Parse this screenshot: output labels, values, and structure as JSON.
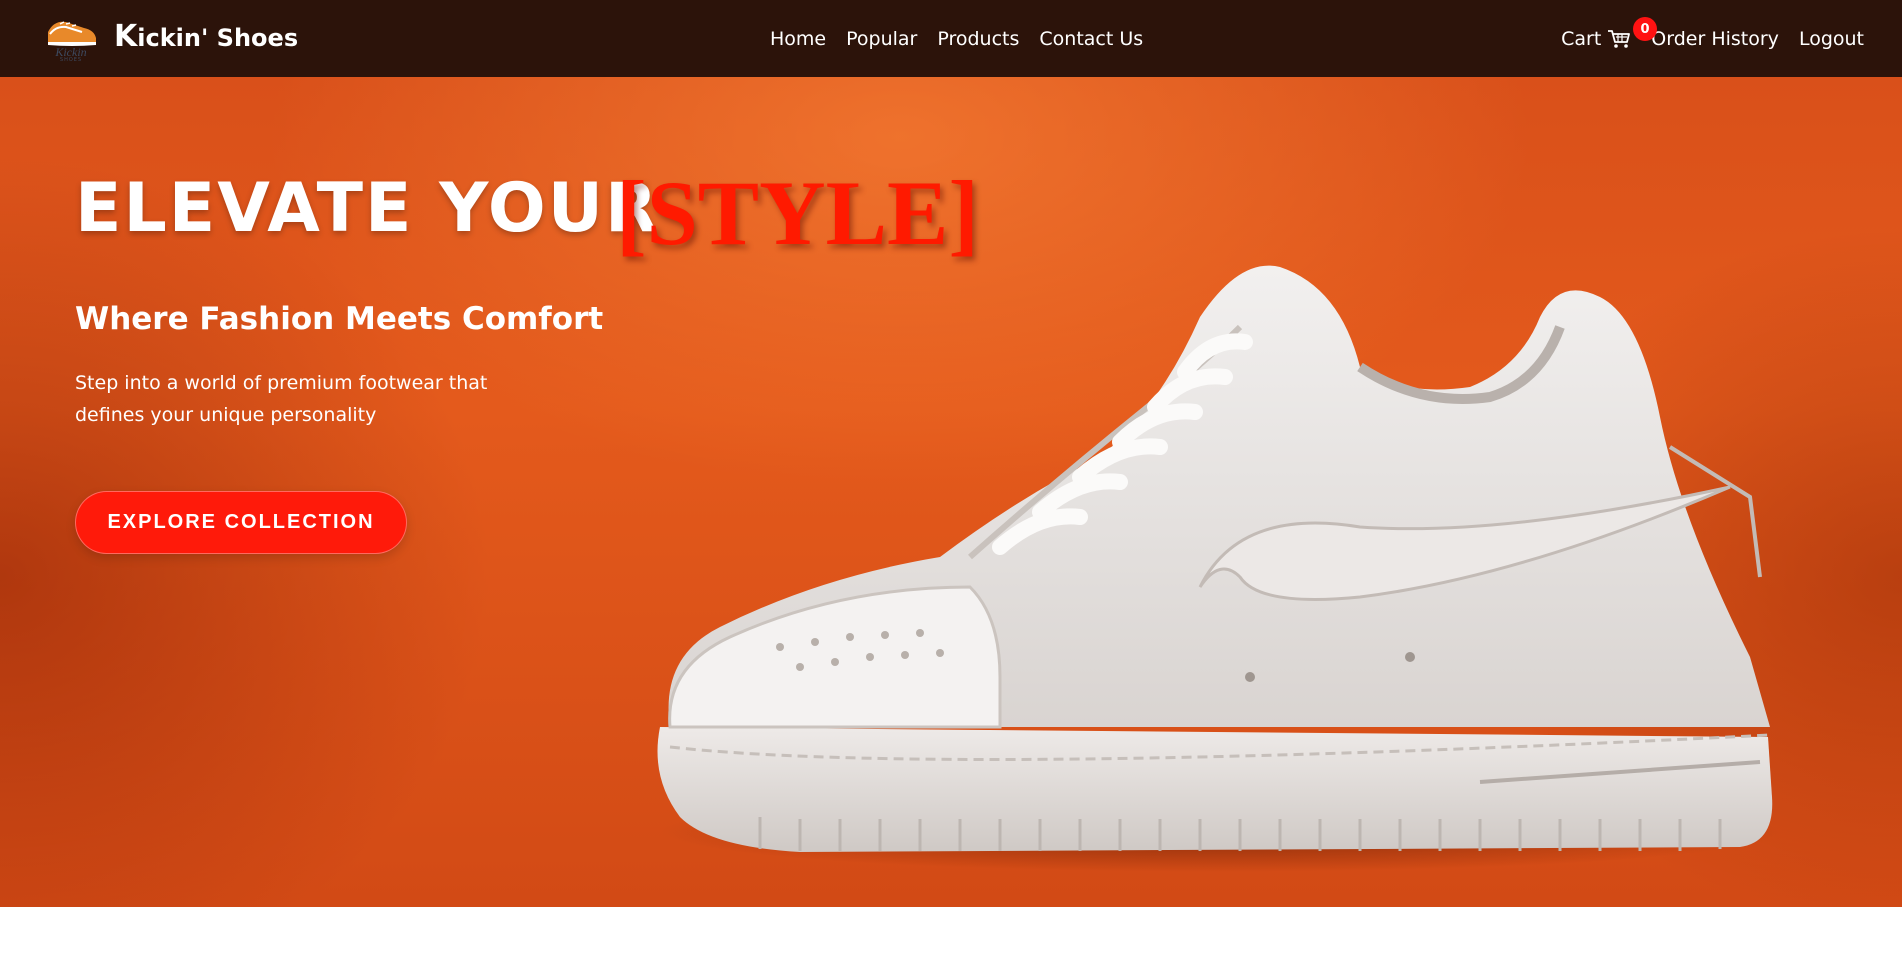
{
  "colors": {
    "navbar_bg": "#2c130a",
    "hero_bg": "#e0561c",
    "accent": "#ff1a00",
    "button_bg": "#ff1a0a",
    "badge_bg": "#ff1212"
  },
  "brand": {
    "logo_icon": "sneaker-logo-icon",
    "name_initial": "K",
    "name_rest": "ickin' Shoes"
  },
  "nav": {
    "home": "Home",
    "popular": "Popular",
    "products": "Products",
    "contact": "Contact Us"
  },
  "nav_right": {
    "cart_label": "Cart",
    "cart_icon": "shopping-cart-icon",
    "cart_count": "0",
    "order_history": "Order History",
    "logout": "Logout"
  },
  "hero": {
    "title": "ELEVATE YOUR",
    "title_accent": "[STYLE]",
    "subtitle": "Where Fashion Meets Comfort",
    "description": "Step into a world of premium footwear that defines your unique personality",
    "cta": "EXPLORE COLLECTION",
    "image": "white-sneaker-image"
  }
}
